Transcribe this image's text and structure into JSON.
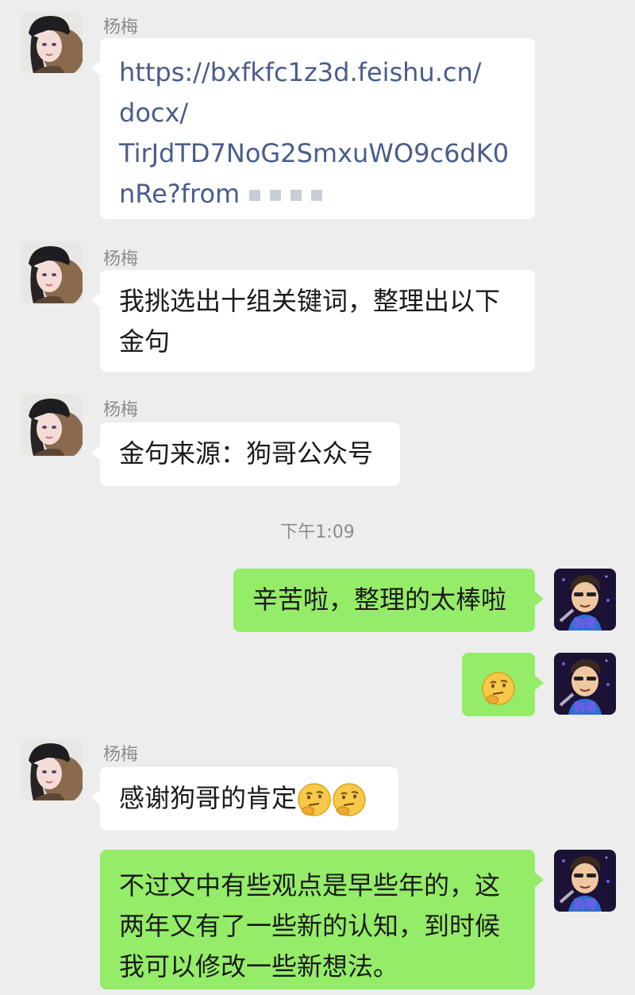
{
  "chat": {
    "sender_name": "杨梅",
    "timestamp": "下午1:09",
    "messages": [
      {
        "side": "in",
        "lines": [
          "https://bxfkfc1z3d.feishu.cn/",
          "docx/",
          "TirJdTD7NoG2SmxuWO9c6dK0",
          "nRe?from"
        ]
      },
      {
        "side": "in",
        "lines": [
          "我挑选出十组关键词，整理出以下",
          "金句"
        ]
      },
      {
        "side": "in",
        "lines": [
          "金句来源：狗哥公众号"
        ]
      },
      {
        "side": "out",
        "lines": [
          "辛苦啦，整理的太棒啦"
        ]
      },
      {
        "side": "out",
        "emoji": "thinking-emoji"
      },
      {
        "side": "in",
        "lines": [
          "感谢狗哥的肯定"
        ],
        "emoji": "thinking-emoji"
      },
      {
        "side": "out",
        "lines": [
          "不过文中有些观点是早些年的，这",
          "两年又有了一些新的认知，到时候",
          "我可以修改一些新想法。"
        ]
      }
    ]
  },
  "avatars": {
    "incoming_icon": "girl-avatar-icon",
    "outgoing_icon": "cartoon-man-avatar-icon",
    "outgoing_caption": "狗哥"
  },
  "colors": {
    "background": "#ededed",
    "incoming_bubble": "#ffffff",
    "outgoing_bubble": "#95ec69",
    "link": "#4a5c8c",
    "meta_text": "#8c8c8c"
  }
}
